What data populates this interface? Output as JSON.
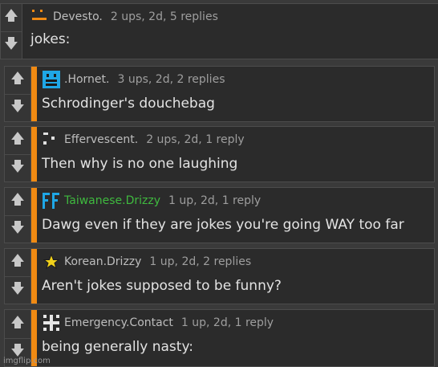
{
  "comments": [
    {
      "username": "Devesto.",
      "stats": "2 ups, 2d, 5 replies",
      "text": "jokes:",
      "avatar": "orange-face-icon"
    },
    {
      "username": ".Hornet.",
      "stats": "3 ups, 2d, 2 replies",
      "text": "Schrodinger's douchebag",
      "avatar": "blue-block-icon"
    },
    {
      "username": "Effervescent.",
      "stats": "2 ups, 2d, 1 reply",
      "text": "Then why is no one laughing",
      "avatar": "pixel-pattern-icon"
    },
    {
      "username": "Taiwanese.Drizzy",
      "stats": "1 up, 2d, 1 reply",
      "text": "Dawg even if they are jokes you're going WAY too far",
      "avatar": "blue-ff-icon"
    },
    {
      "username": "Korean.Drizzy",
      "stats": "1 up, 2d, 2 replies",
      "text": "Aren't jokes supposed to be funny?",
      "avatar": "star-icon"
    },
    {
      "username": "Emergency.Contact",
      "stats": "1 up, 2d, 1 reply",
      "text": "being generally nasty:",
      "avatar": "white-glyph-icon"
    }
  ],
  "colors": {
    "accent": "#f08a13",
    "background": "#3a3a3a",
    "panel": "#2b2b2b",
    "green_username": "#3fb93f"
  },
  "vote": {
    "up": "🡅",
    "down": "🡇"
  },
  "watermark": "imgflip.com"
}
